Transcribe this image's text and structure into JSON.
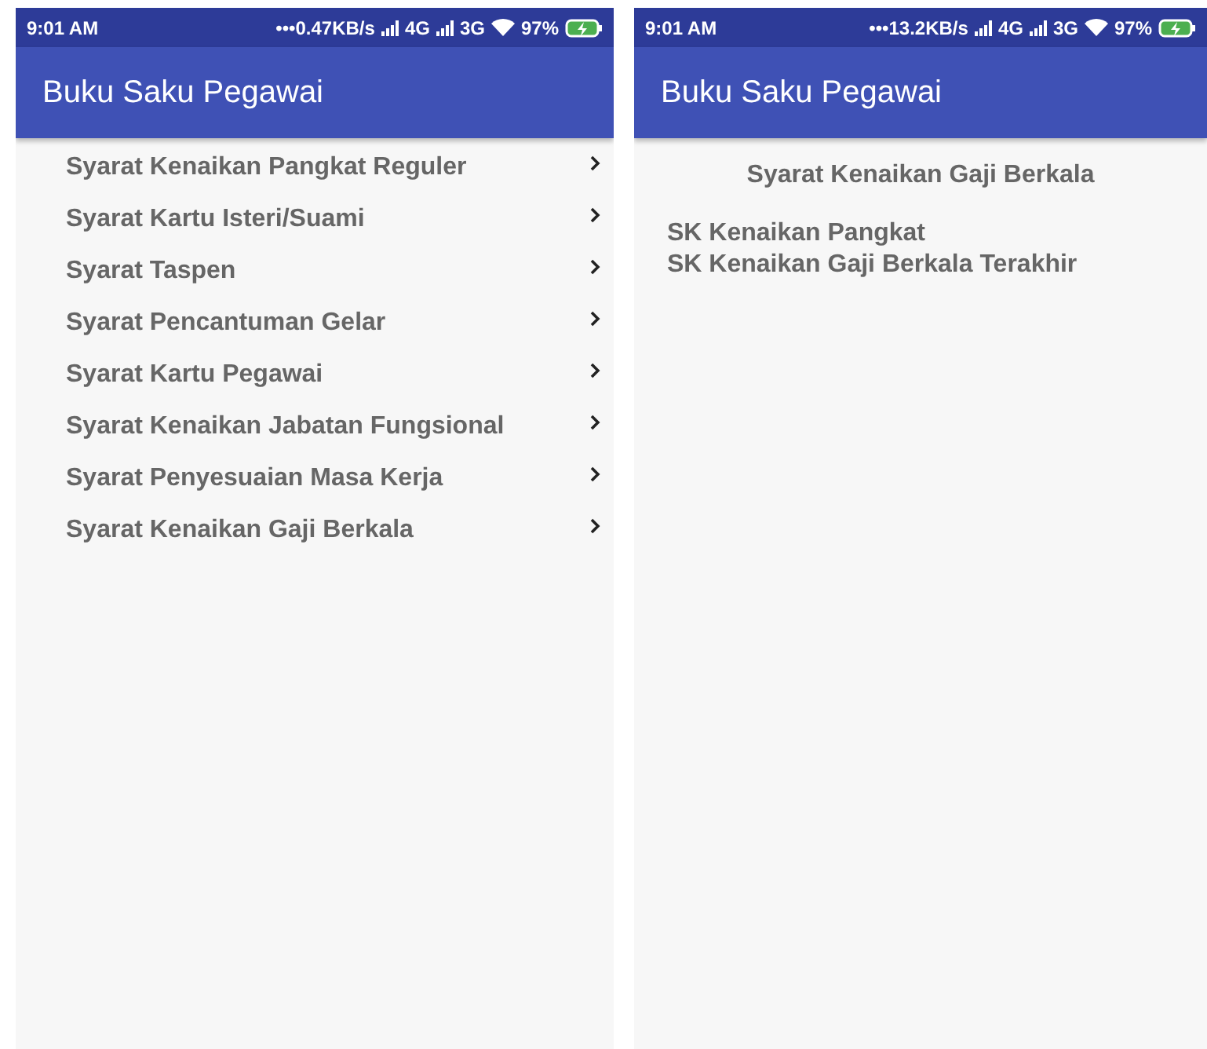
{
  "screens": [
    {
      "status_bar": {
        "time": "9:01 AM",
        "speed": "•••0.47KB/s",
        "network_1": "4G",
        "network_2": "3G",
        "battery": "97%"
      },
      "app_bar": {
        "title": "Buku Saku Pegawai"
      },
      "content": {
        "kind": "menu",
        "items": [
          {
            "label": "Syarat Kenaikan Pangkat Reguler"
          },
          {
            "label": "Syarat Kartu Isteri/Suami"
          },
          {
            "label": "Syarat Taspen"
          },
          {
            "label": "Syarat Pencantuman Gelar"
          },
          {
            "label": "Syarat Kartu Pegawai"
          },
          {
            "label": "Syarat Kenaikan Jabatan Fungsional"
          },
          {
            "label": "Syarat Penyesuaian Masa Kerja"
          },
          {
            "label": "Syarat Kenaikan Gaji Berkala"
          }
        ]
      }
    },
    {
      "status_bar": {
        "time": "9:01 AM",
        "speed": "•••13.2KB/s",
        "network_1": "4G",
        "network_2": "3G",
        "battery": "97%"
      },
      "app_bar": {
        "title": "Buku Saku Pegawai"
      },
      "content": {
        "kind": "detail",
        "heading": "Syarat Kenaikan Gaji Berkala",
        "lines": [
          "SK Kenaikan Pangkat",
          "SK Kenaikan Gaji Berkala Terakhir"
        ]
      }
    }
  ]
}
